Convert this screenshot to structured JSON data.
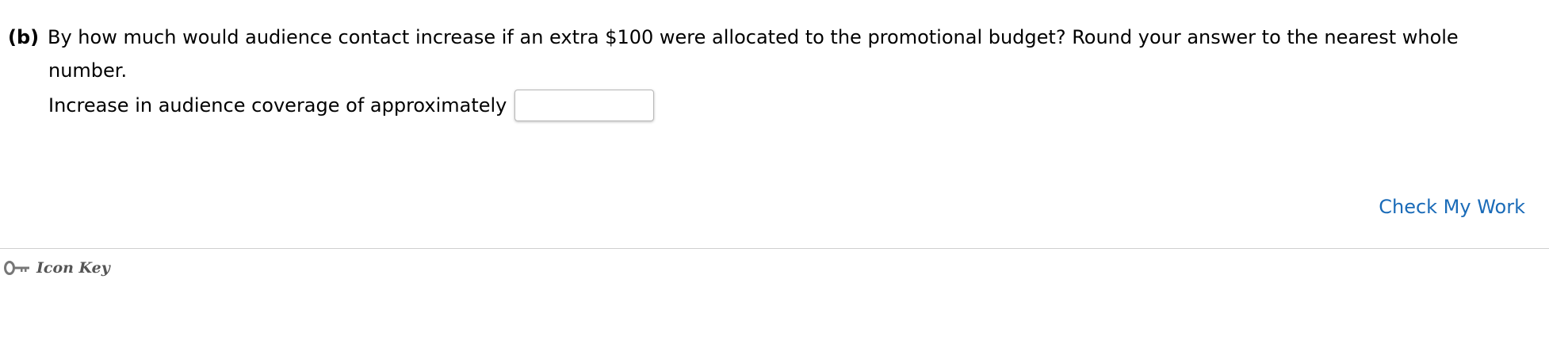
{
  "question": {
    "label": "(b)",
    "line1": "By how much would audience contact increase if an extra $100 were allocated to the promotional budget? Round your answer to the nearest whole",
    "line2": "number."
  },
  "answer": {
    "prompt": "Increase in audience coverage of approximately",
    "value": ""
  },
  "actions": {
    "check_label": "Check My Work"
  },
  "footer": {
    "icon_key_label": "Icon Key",
    "icon": "key-icon"
  }
}
